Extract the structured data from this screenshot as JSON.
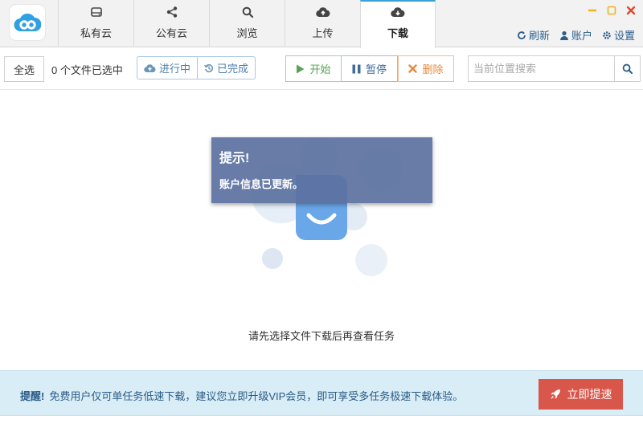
{
  "tabs": [
    {
      "label": "私有云",
      "icon": "drive-icon"
    },
    {
      "label": "公有云",
      "icon": "share-icon"
    },
    {
      "label": "浏览",
      "icon": "search-icon"
    },
    {
      "label": "上传",
      "icon": "cloud-upload-icon"
    },
    {
      "label": "下载",
      "icon": "cloud-download-icon",
      "active": true
    }
  ],
  "top_links": {
    "refresh": "刷新",
    "account": "账户",
    "settings": "设置"
  },
  "toolbar": {
    "select_all": "全选",
    "selected_count": "0 个文件已选中",
    "filter_in_progress": "进行中",
    "filter_completed": "已完成",
    "start": "开始",
    "pause": "暂停",
    "delete": "删除",
    "search_placeholder": "当前位置搜索",
    "search_value": ""
  },
  "toast": {
    "title": "提示!",
    "message": "账户信息已更新。"
  },
  "empty_state": {
    "text": "请先选择文件下载后再查看任务"
  },
  "banner": {
    "label": "提醒!",
    "text": "免费用户仅可单任务低速下载，建议您立即升级VIP会员，即可享受多任务极速下载体验。",
    "button": "立即提速"
  },
  "colors": {
    "accent": "#3aa0d8",
    "start": "#5aa257",
    "pause": "#3f6b94",
    "delete": "#e58a3c",
    "speed_button": "#d9574a",
    "banner_bg": "#d8edf6",
    "toast_bg": "#5c719f"
  }
}
